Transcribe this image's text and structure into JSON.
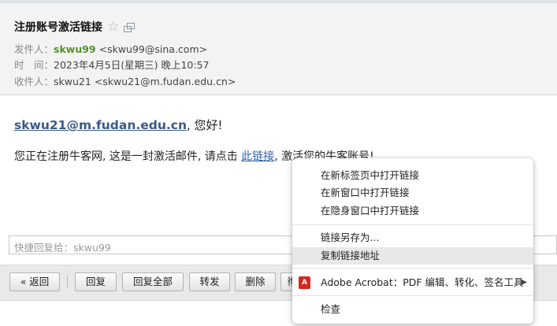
{
  "email": {
    "subject": "注册账号激活链接",
    "from_label": "发件人：",
    "from_name": "skwu99",
    "from_addr": "<skwu99@sina.com>",
    "time_label": "时　间：",
    "time_value": "2023年4月5日(星期三) 晚上10:57",
    "to_label": "收件人：",
    "to_name": "skwu21",
    "to_addr": "<skwu21@m.fudan.edu.cn>",
    "greeting_addr": "skwu21@m.fudan.edu.cn",
    "greeting_suffix": ", 您好!",
    "body_prefix": "您正在注册牛客网, 这是一封激活邮件, 请点击 ",
    "body_link": "此链接",
    "body_suffix": ", 激活您的牛客账号!"
  },
  "reply": {
    "placeholder": "快捷回复给：skwu99"
  },
  "toolbar": {
    "back": "« 返回",
    "reply": "回复",
    "reply_all": "回复全部",
    "forward": "转发",
    "delete": "删除",
    "partial": "彻"
  },
  "context_menu": {
    "items": [
      "在新标签页中打开链接",
      "在新窗口中打开链接",
      "在隐身窗口中打开链接",
      "链接另存为...",
      "复制链接地址",
      "Adobe Acrobat：PDF 编辑、转化、签名工具",
      "检查"
    ],
    "highlighted_index": 4
  },
  "colors": {
    "sender": "#55902a",
    "link": "#2f5fa3",
    "pdf_red": "#d8251d"
  },
  "icons": [
    "star-icon",
    "popout-icon",
    "adobe-pdf-icon",
    "submenu-arrow-icon"
  ]
}
